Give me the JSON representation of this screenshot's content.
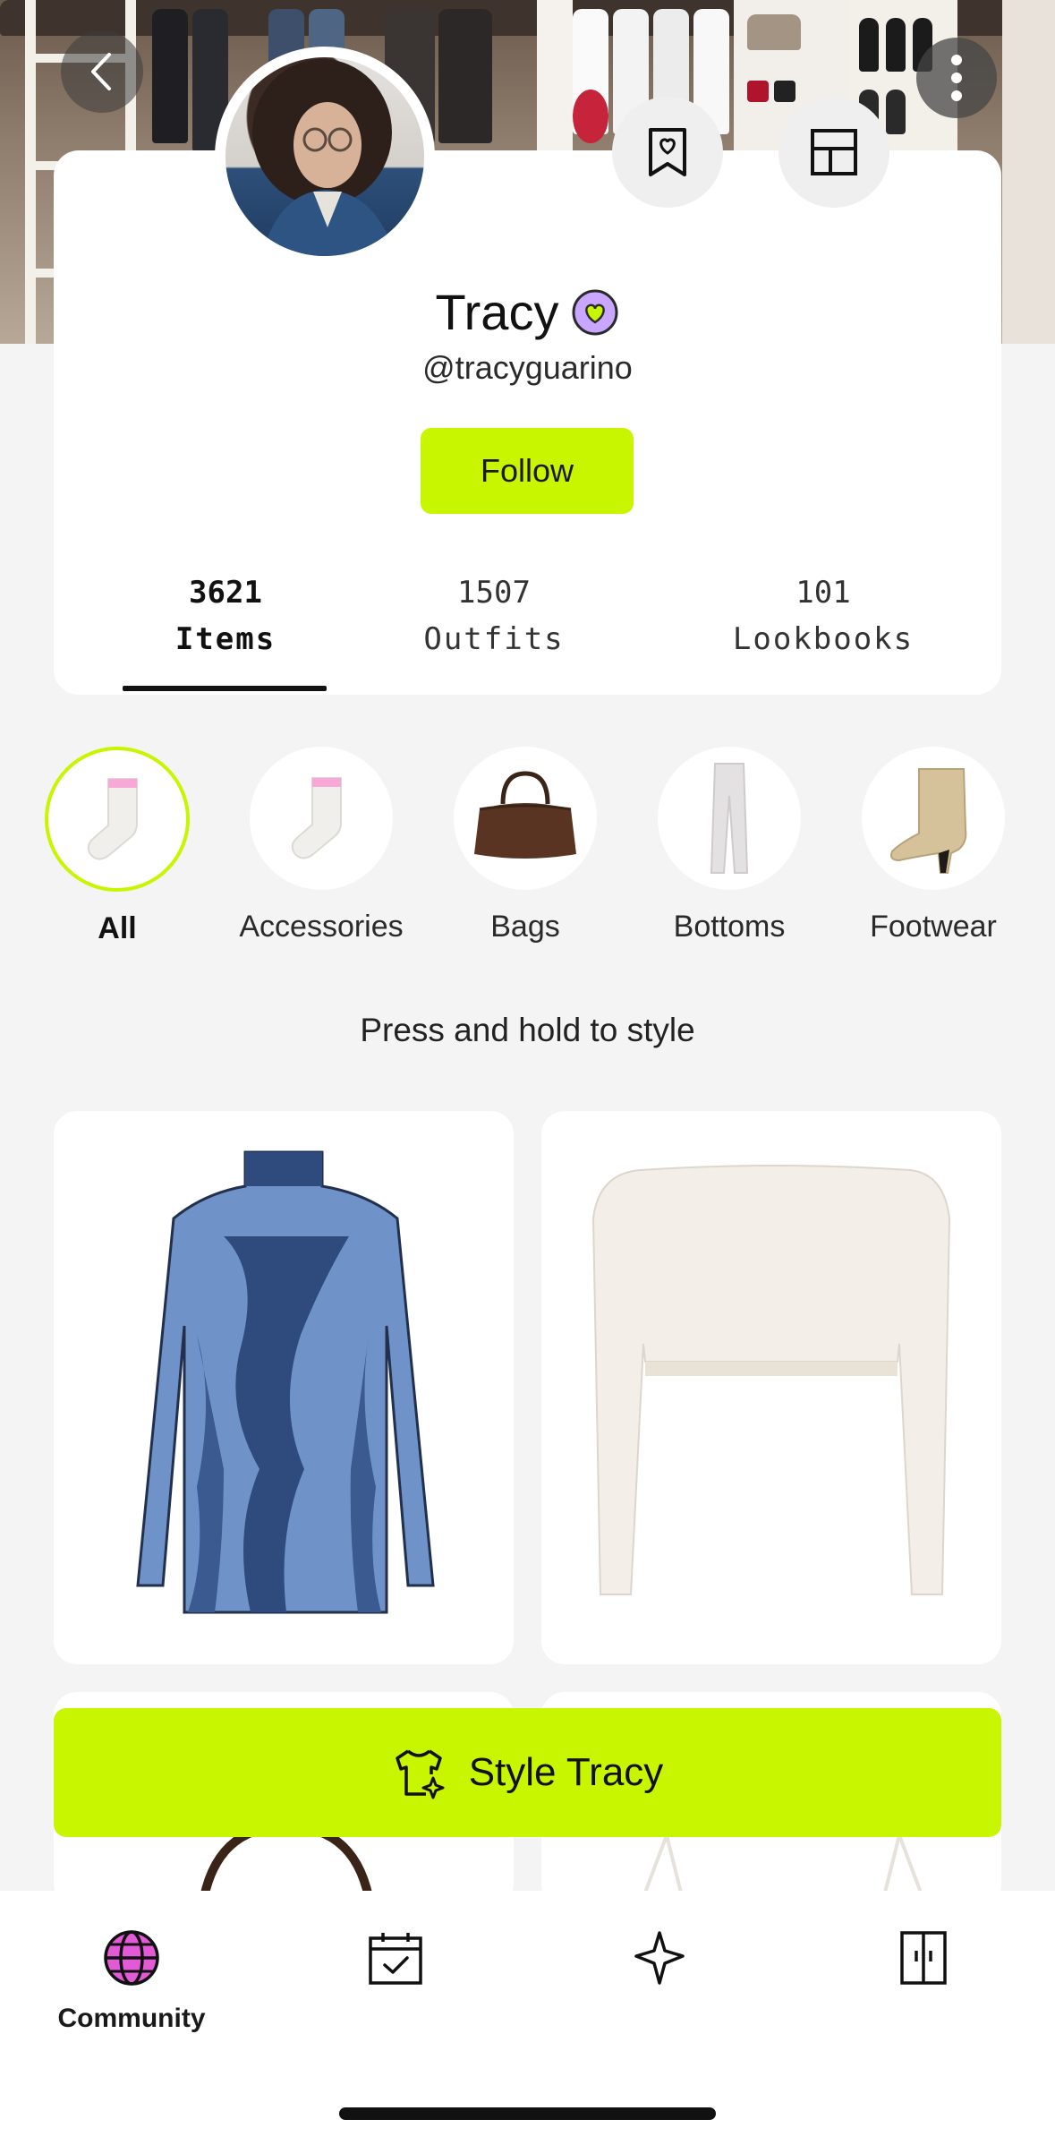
{
  "profile": {
    "name": "Tracy",
    "handle": "@tracyguarino",
    "follow_label": "Follow",
    "badge_icon": "heart-badge-icon",
    "accent_color": "#c8f500",
    "badge_color": "#c9a6ff"
  },
  "stats": [
    {
      "count": "3621",
      "label": "Items"
    },
    {
      "count": "1507",
      "label": "Outfits"
    },
    {
      "count": "101",
      "label": "Lookbooks"
    }
  ],
  "categories": [
    {
      "label": "All"
    },
    {
      "label": "Accessories"
    },
    {
      "label": "Bags"
    },
    {
      "label": "Bottoms"
    },
    {
      "label": "Footwear"
    }
  ],
  "hint": "Press and hold to style",
  "cta": {
    "label": "Style Tracy"
  },
  "nav": {
    "community_label": "Community"
  }
}
